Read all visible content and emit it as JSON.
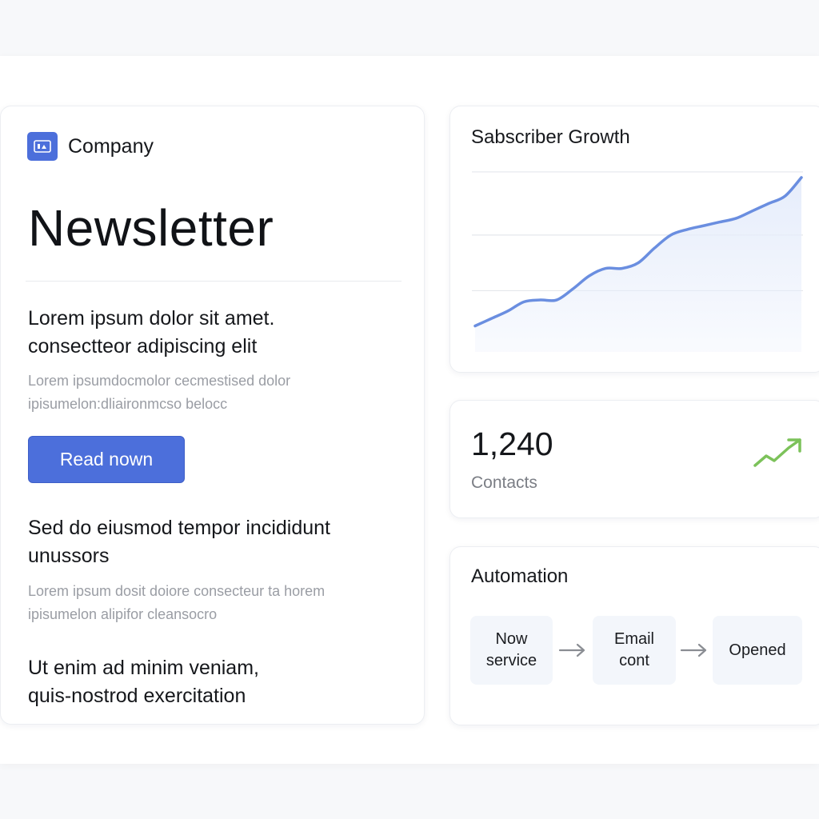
{
  "newsletter": {
    "brand_name": "Company",
    "brand_icon": "company-logo-icon",
    "headline": "Newsletter",
    "sections": [
      {
        "title_lines": [
          "Lorem ipsum dolor sit amet.",
          "consectteor adipiscing elit"
        ],
        "body_lines": [
          "Lorem ipsumdocmolor cecmestised dolor",
          "ipisumelon:dliaironmcso belocc"
        ]
      },
      {
        "title_lines": [
          "Sed do eiusmod tempor incididunt",
          "unussors"
        ],
        "body_lines": [
          "Lorem ipsum dosit doiore consecteur ta horem",
          "ipisumelon alipifor cleansocro"
        ]
      },
      {
        "title_lines": [
          "Ut enim ad minim veniam,",
          "quis-nostrod exercitation"
        ],
        "body_lines": []
      }
    ],
    "cta_label": "Read nown"
  },
  "growth": {
    "title": "Sabscriber Growth",
    "line_color": "#6a8ee0",
    "fill_color": "#e6edfb"
  },
  "chart_data": {
    "type": "area",
    "title": "Sabscriber Growth",
    "xlabel": "",
    "ylabel": "",
    "x": [
      0,
      1,
      2,
      3,
      4,
      5,
      6,
      7,
      8,
      9,
      10,
      11,
      12,
      13,
      14,
      15,
      16,
      17,
      18,
      19,
      20
    ],
    "values": [
      14,
      18,
      22,
      27,
      28,
      28,
      34,
      41,
      45,
      45,
      48,
      56,
      63,
      66,
      68,
      70,
      72,
      76,
      80,
      84,
      94
    ],
    "ylim": [
      0,
      100
    ],
    "grid": true,
    "gridlines": [
      33,
      63,
      97
    ]
  },
  "contacts": {
    "value": "1,240",
    "label": "Contacts",
    "trend_icon": "trend-up-icon",
    "trend_color": "#7cc25a"
  },
  "automation": {
    "title": "Automation",
    "steps": [
      {
        "lines": [
          "Now",
          "service"
        ]
      },
      {
        "lines": [
          "Email",
          "cont"
        ]
      },
      {
        "lines": [
          "Opened"
        ]
      }
    ],
    "arrow_icon": "arrow-right-icon"
  }
}
